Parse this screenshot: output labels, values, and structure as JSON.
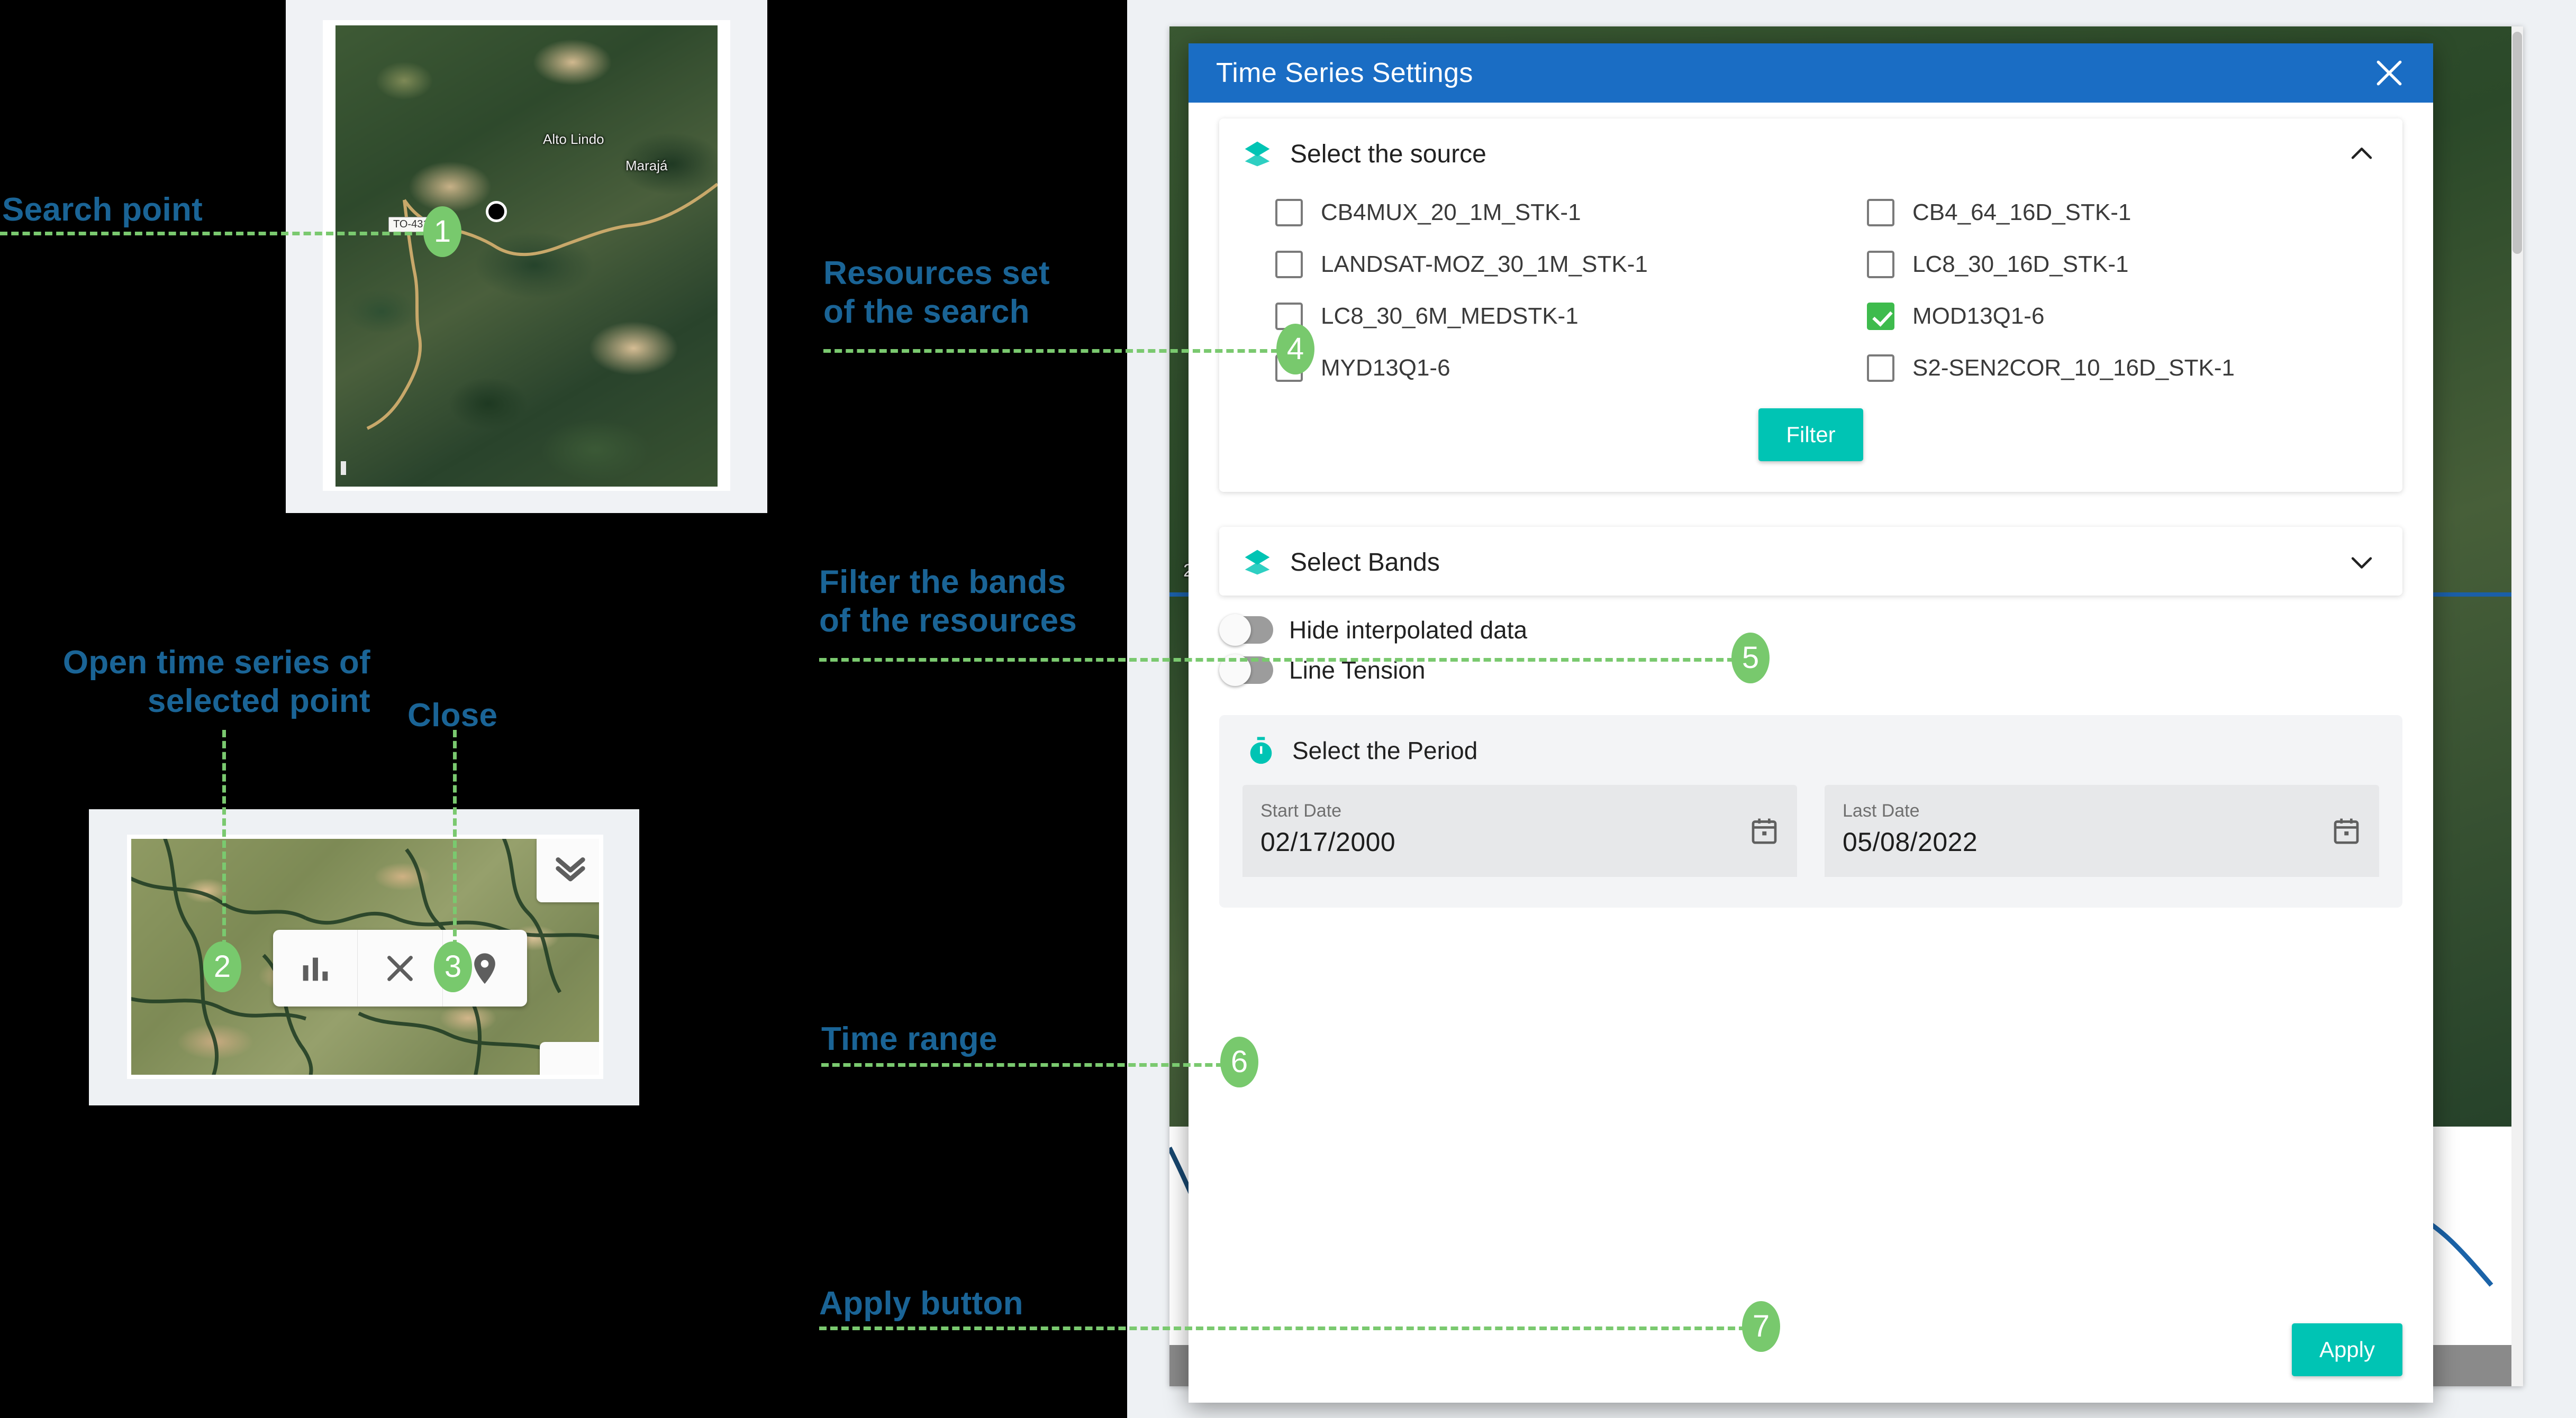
{
  "annotations": [
    {
      "id": 1,
      "number": "1",
      "label": "Search point"
    },
    {
      "id": 2,
      "number": "2",
      "label": "Open time series of\nselected point"
    },
    {
      "id": 3,
      "number": "3",
      "label": "Close"
    },
    {
      "id": 4,
      "number": "4",
      "label": "Resources set\nof the search"
    },
    {
      "id": 5,
      "number": "5",
      "label": "Filter the bands\nof the resources"
    },
    {
      "id": 6,
      "number": "6",
      "label": "Time range"
    },
    {
      "id": 7,
      "number": "7",
      "label": "Apply button"
    }
  ],
  "colors": {
    "annotation_text": "#1a6496",
    "annotation_badge": "#78c96d",
    "annotation_line": "#7ac96f",
    "header_blue": "#1a6dc4",
    "accent_teal": "#00c4b4",
    "checkbox_checked": "#3ebb4d"
  },
  "map_thumb_search": {
    "place_labels": [
      "Alto Lindo",
      "Marajá"
    ],
    "road_shield": "TO-431"
  },
  "map_thumb_toolbar": {
    "buttons": [
      {
        "name": "chart-icon",
        "title": "Open time series"
      },
      {
        "name": "close-icon",
        "title": "Close"
      },
      {
        "name": "marker-icon",
        "title": "Marker"
      },
      {
        "name": "collapse-icon",
        "title": "Collapse"
      }
    ]
  },
  "modal": {
    "title": "Time Series Settings",
    "close_icon": "close-icon",
    "source_section": {
      "title": "Select the source",
      "icon": "layers-icon",
      "chevron": "chevron-up-icon",
      "expanded": true,
      "sources": [
        {
          "label": "CB4MUX_20_1M_STK-1",
          "checked": false
        },
        {
          "label": "CB4_64_16D_STK-1",
          "checked": false
        },
        {
          "label": "LANDSAT-MOZ_30_1M_STK-1",
          "checked": false
        },
        {
          "label": "LC8_30_16D_STK-1",
          "checked": false
        },
        {
          "label": "LC8_30_6M_MEDSTK-1",
          "checked": false
        },
        {
          "label": "MOD13Q1-6",
          "checked": true
        },
        {
          "label": "MYD13Q1-6",
          "checked": false
        },
        {
          "label": "S2-SEN2COR_10_16D_STK-1",
          "checked": false
        }
      ],
      "filter_button": "Filter"
    },
    "bands_section": {
      "title": "Select Bands",
      "icon": "layers-icon",
      "chevron": "chevron-down-icon",
      "expanded": false
    },
    "toggles": [
      {
        "label": "Hide interpolated data",
        "on": false
      },
      {
        "label": "Line Tension",
        "on": false
      }
    ],
    "period_section": {
      "title": "Select the Period",
      "icon": "timer-icon",
      "start": {
        "label": "Start Date",
        "value": "02/17/2000",
        "icon": "calendar-icon"
      },
      "end": {
        "label": "Last Date",
        "value": "05/08/2022",
        "icon": "calendar-icon"
      }
    },
    "apply_button": "Apply"
  }
}
